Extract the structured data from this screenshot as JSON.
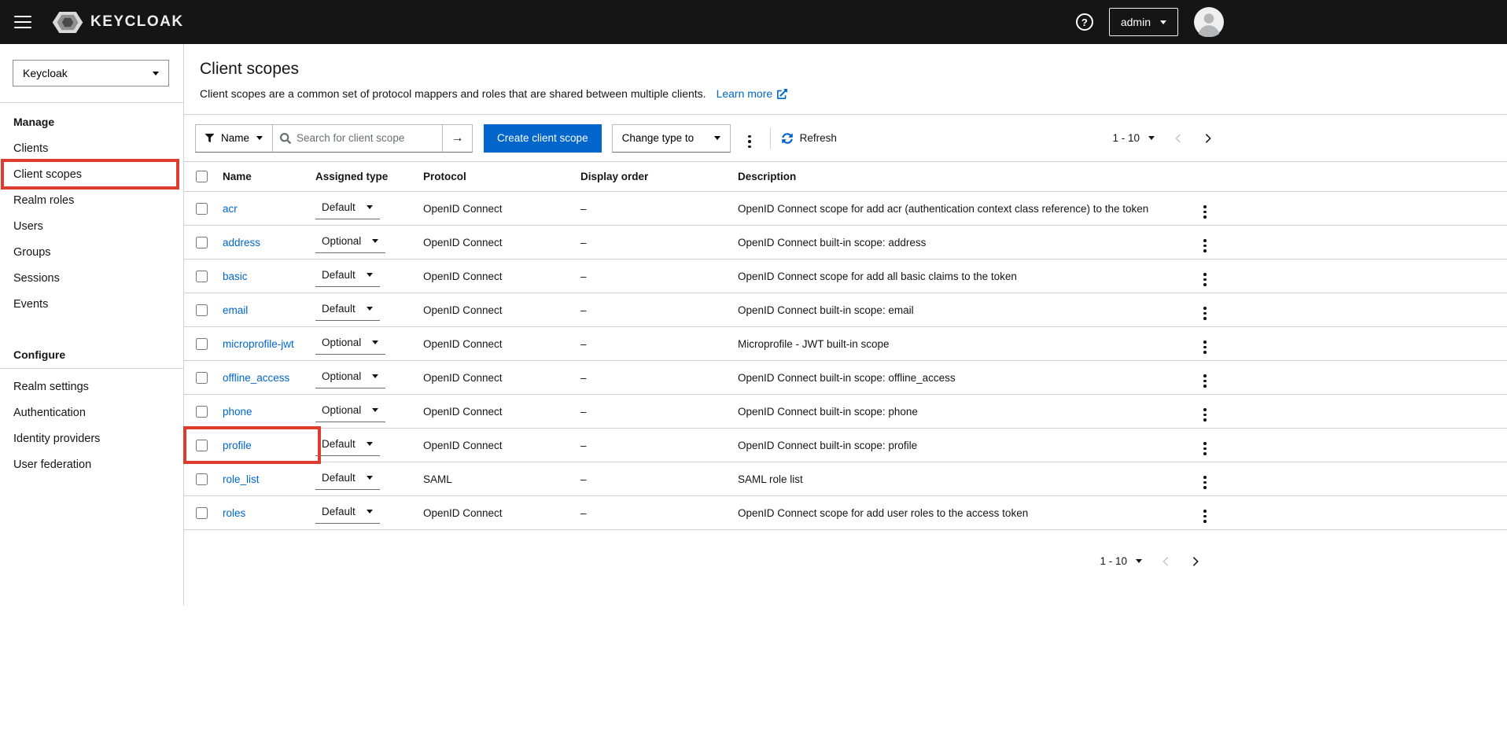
{
  "colors": {
    "annotation": "#dd3c2e",
    "accent": "#0066cc",
    "header_bg": "#151515"
  },
  "icons": {
    "arrow_right": "→",
    "help": "?"
  },
  "header": {
    "brand": "KEYCLOAK",
    "username": "admin"
  },
  "sidebar": {
    "realm_select": "Keycloak",
    "sections": [
      {
        "label": "Manage",
        "items": [
          {
            "label": "Clients"
          },
          {
            "label": "Client scopes"
          },
          {
            "label": "Realm roles"
          },
          {
            "label": "Users"
          },
          {
            "label": "Groups"
          },
          {
            "label": "Sessions"
          },
          {
            "label": "Events"
          }
        ]
      },
      {
        "label": "Configure",
        "items": [
          {
            "label": "Realm settings"
          },
          {
            "label": "Authentication"
          },
          {
            "label": "Identity providers"
          },
          {
            "label": "User federation"
          }
        ]
      }
    ]
  },
  "page": {
    "title": "Client scopes",
    "description": "Client scopes are a common set of protocol mappers and roles that are shared between multiple clients.",
    "learn_more_label": "Learn more"
  },
  "toolbar": {
    "filter_label": "Name",
    "search_placeholder": "Search for client scope",
    "create_button_label": "Create client scope",
    "change_type_label": "Change type to",
    "refresh_label": "Refresh",
    "pagination_label": "1 - 10"
  },
  "table": {
    "headers": {
      "name": "Name",
      "assigned_type": "Assigned type",
      "protocol": "Protocol",
      "display_order": "Display order",
      "description": "Description"
    },
    "rows": [
      {
        "name": "acr",
        "type": "Default",
        "protocol": "OpenID Connect",
        "order": "–",
        "description": "OpenID Connect scope for add acr (authentication context class reference) to the token"
      },
      {
        "name": "address",
        "type": "Optional",
        "protocol": "OpenID Connect",
        "order": "–",
        "description": "OpenID Connect built-in scope: address"
      },
      {
        "name": "basic",
        "type": "Default",
        "protocol": "OpenID Connect",
        "order": "–",
        "description": "OpenID Connect scope for add all basic claims to the token"
      },
      {
        "name": "email",
        "type": "Default",
        "protocol": "OpenID Connect",
        "order": "–",
        "description": "OpenID Connect built-in scope: email"
      },
      {
        "name": "microprofile-jwt",
        "type": "Optional",
        "protocol": "OpenID Connect",
        "order": "–",
        "description": "Microprofile - JWT built-in scope"
      },
      {
        "name": "offline_access",
        "type": "Optional",
        "protocol": "OpenID Connect",
        "order": "–",
        "description": "OpenID Connect built-in scope: offline_access"
      },
      {
        "name": "phone",
        "type": "Optional",
        "protocol": "OpenID Connect",
        "order": "–",
        "description": "OpenID Connect built-in scope: phone"
      },
      {
        "name": "profile",
        "type": "Default",
        "protocol": "OpenID Connect",
        "order": "–",
        "description": "OpenID Connect built-in scope: profile",
        "annotated": true
      },
      {
        "name": "role_list",
        "type": "Default",
        "protocol": "SAML",
        "order": "–",
        "description": "SAML role list"
      },
      {
        "name": "roles",
        "type": "Default",
        "protocol": "OpenID Connect",
        "order": "–",
        "description": "OpenID Connect scope for add user roles to the access token"
      }
    ]
  },
  "footer": {
    "pagination_label": "1 - 10"
  }
}
